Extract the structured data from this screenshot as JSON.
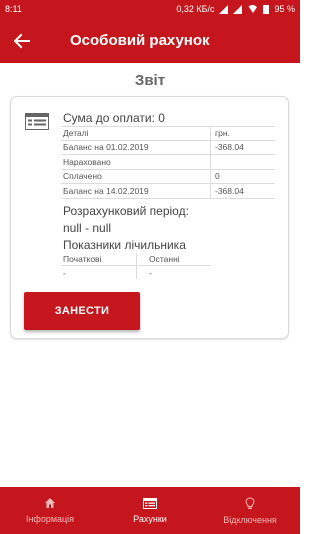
{
  "statusbar": {
    "time": "8:11",
    "speed": "0,32 КБ/с",
    "battery": "95 %"
  },
  "appbar": {
    "title": "Особовий рахунок"
  },
  "section": {
    "title": "Звіт"
  },
  "card": {
    "sum_label": "Сума до оплати: 0",
    "table": {
      "header": [
        "Деталі",
        "грн."
      ],
      "rows": [
        [
          "Баланс на 01.02.2019",
          "-368.04"
        ],
        [
          "Нараховано",
          ""
        ],
        [
          "Сплачено",
          "0"
        ],
        [
          "Баланс на 14.02.2019",
          "-368.04"
        ]
      ]
    },
    "period_label": "Розрахунковий період:",
    "period_value": "null - null",
    "meter_label": "Показники лічильника",
    "meter": {
      "header": [
        "Початкові",
        "Останні"
      ],
      "values": [
        "-",
        "-"
      ]
    },
    "submit_label": "ЗАНЕСТИ"
  },
  "bottom_nav": [
    {
      "label": "Інформація",
      "icon": "home-icon",
      "active": false
    },
    {
      "label": "Рахунки",
      "icon": "bill-icon",
      "active": true
    },
    {
      "label": "Відключення",
      "icon": "lightbulb-icon",
      "active": false
    }
  ],
  "colors": {
    "brand": "#c4161c",
    "text": "#444444"
  }
}
